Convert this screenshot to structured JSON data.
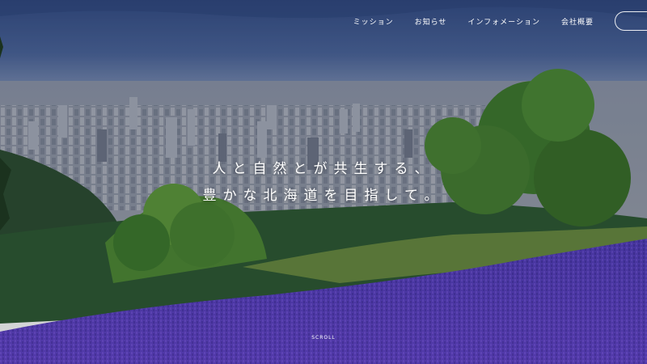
{
  "nav": {
    "items": [
      "ミッション",
      "お知らせ",
      "インフォメーション",
      "会社概要"
    ]
  },
  "hero": {
    "headline_line1": "人と自然とが共生する、",
    "headline_line2": "豊かな北海道を目指して。",
    "scroll_label": "SCROLL"
  },
  "colors": {
    "sky": "#3f5a92",
    "city": "#8c93a3",
    "forest": "#2f5f34",
    "lavender": "#5b3ec4"
  },
  "icons": []
}
